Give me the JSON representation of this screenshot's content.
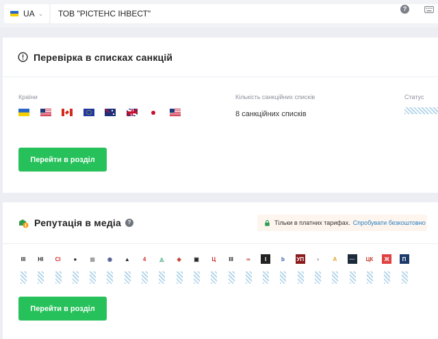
{
  "topbar": {
    "country_code": "UA",
    "search_value": "ТОВ \"РІСТЕНС ІНВЕСТ\"",
    "help_glyph": "?",
    "icons": [
      "ua-flag-icon",
      "chevron-down-icon",
      "help-icon",
      "keyboard-icon"
    ]
  },
  "sanctions": {
    "title": "Перевірка в списках санкцій",
    "icon": "alert-circle-icon",
    "countries_label": "Країни",
    "lists_count_label": "Кількість санкційних списків",
    "status_label": "Статус",
    "flags": [
      "ukraine",
      "usa",
      "canada",
      "european-union",
      "australia",
      "united-kingdom",
      "japan",
      "usa"
    ],
    "lists_count_text": "8 санкційних списків",
    "button_label": "Перейти в розділ"
  },
  "media": {
    "title": "Репутація в медіа",
    "icon": "media-reputation-icon",
    "help_glyph": "?",
    "paid_text": "Тільки в платних тарифах.",
    "paid_link": "Спробувати безкоштовно",
    "sources": [
      {
        "name": "source-1",
        "glyph": "ІІІ",
        "fg": "#222222",
        "bg": "#ffffff"
      },
      {
        "name": "source-2",
        "glyph": "НІ",
        "fg": "#222222",
        "bg": "#ffffff"
      },
      {
        "name": "source-3",
        "glyph": "CI",
        "fg": "#d22a2a",
        "bg": "#ffffff"
      },
      {
        "name": "source-4",
        "glyph": "●",
        "fg": "#222222",
        "bg": "#ffffff"
      },
      {
        "name": "source-5",
        "glyph": "▦",
        "fg": "#999999",
        "bg": "#ffffff"
      },
      {
        "name": "source-6",
        "glyph": "◉",
        "fg": "#4a5a8a",
        "bg": "#ffffff"
      },
      {
        "name": "source-7",
        "glyph": "▲",
        "fg": "#222222",
        "bg": "#ffffff"
      },
      {
        "name": "source-8",
        "glyph": "4",
        "fg": "#d22a2a",
        "bg": "#ffffff"
      },
      {
        "name": "source-9",
        "glyph": "◬",
        "fg": "#2a9a6a",
        "bg": "#ffffff"
      },
      {
        "name": "source-10",
        "glyph": "◈",
        "fg": "#c0392b",
        "bg": "#ffffff"
      },
      {
        "name": "source-11",
        "glyph": "▣",
        "fg": "#222222",
        "bg": "#ffffff"
      },
      {
        "name": "source-12",
        "glyph": "Ц",
        "fg": "#d22a2a",
        "bg": "#ffffff"
      },
      {
        "name": "source-13",
        "glyph": "ІІІ",
        "fg": "#222222",
        "bg": "#ffffff"
      },
      {
        "name": "source-14",
        "glyph": "∞",
        "fg": "#c0392b",
        "bg": "#ffffff"
      },
      {
        "name": "source-15",
        "glyph": "I",
        "fg": "#ffffff",
        "bg": "#222222"
      },
      {
        "name": "source-16",
        "glyph": "b",
        "fg": "#2a5aa8",
        "bg": "#ffffff"
      },
      {
        "name": "source-17",
        "glyph": "УП",
        "fg": "#ffffff",
        "bg": "#8b1a1a"
      },
      {
        "name": "source-18",
        "glyph": "◑",
        "fg": "#999999",
        "bg": "#ffffff"
      },
      {
        "name": "source-19",
        "glyph": "A",
        "fg": "#e0a020",
        "bg": "#ffffff"
      },
      {
        "name": "source-20",
        "glyph": "···",
        "fg": "#ffffff",
        "bg": "#1d2a3a"
      },
      {
        "name": "source-21",
        "glyph": "ЦК",
        "fg": "#c0392b",
        "bg": "#ffffff"
      },
      {
        "name": "source-22",
        "glyph": "Ж",
        "fg": "#ffffff",
        "bg": "#e04040"
      },
      {
        "name": "source-23",
        "glyph": "П",
        "fg": "#ffffff",
        "bg": "#1d3a6a"
      }
    ],
    "button_label": "Перейти в розділ"
  }
}
